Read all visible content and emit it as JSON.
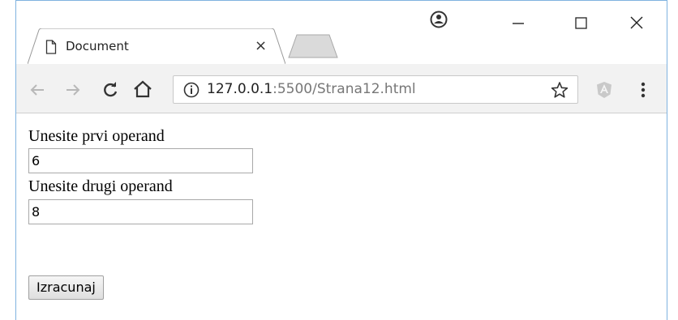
{
  "browser": {
    "tab": {
      "title": "Document",
      "close_glyph": "×",
      "icon": "document-icon"
    },
    "window_controls": {
      "profile_icon": "account-icon",
      "minimize_icon": "minimize-icon",
      "maximize_icon": "maximize-icon",
      "close_icon": "close-icon"
    },
    "toolbar": {
      "back_icon": "arrow-left-icon",
      "forward_icon": "arrow-right-icon",
      "reload_icon": "reload-icon",
      "home_icon": "home-icon",
      "info_icon": "info-icon",
      "bookmark_icon": "star-icon",
      "extension_icon": "angular-extension-icon",
      "menu_icon": "kebab-menu-icon"
    },
    "address": {
      "host": "127.0.0.1",
      "rest": ":5500/Strana12.html"
    }
  },
  "page": {
    "first_label": "Unesite prvi operand",
    "first_value": "6",
    "second_label": "Unesite drugi operand",
    "second_value": "8",
    "submit_label": "Izracunaj"
  },
  "colors": {
    "frame": "#7fb3e0",
    "toolbar_bg": "#f2f2f2",
    "url_muted": "#777777"
  }
}
